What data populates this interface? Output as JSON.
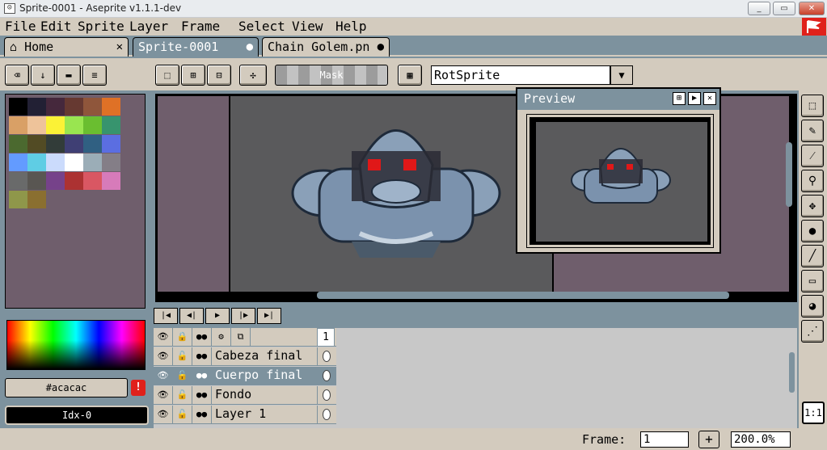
{
  "window": {
    "title": "Sprite-0001 - Aseprite v1.1.1-dev",
    "min": "_",
    "max": "▭",
    "close": "✕"
  },
  "menu": [
    "File",
    "Edit",
    "Sprite",
    "Layer",
    "Frame",
    "Select",
    "View",
    "Help"
  ],
  "tabs": [
    {
      "label": "Home",
      "close": "✕"
    },
    {
      "label": "Sprite-0001",
      "close": "●"
    },
    {
      "label": "Chain Golem.pn",
      "close": "●"
    }
  ],
  "toolbar": {
    "mask_label": "Mask",
    "rotation_algorithm": "RotSprite"
  },
  "palette": {
    "colors": [
      "#000000",
      "#222034",
      "#45283c",
      "#663931",
      "#8f563b",
      "#df7126",
      "#d9a066",
      "#eec39a",
      "#fbf236",
      "#99e550",
      "#6abe30",
      "#37946e",
      "#4b692f",
      "#524b24",
      "#323c39",
      "#3f3f74",
      "#306082",
      "#5b6ee1",
      "#639bff",
      "#5fcde4",
      "#cbdbfc",
      "#ffffff",
      "#9badb7",
      "#847e87",
      "#696a6a",
      "#595652",
      "#76428a",
      "#ac3232",
      "#d95763",
      "#d77bba",
      "#8f974a",
      "#8a6f30"
    ]
  },
  "color_bar": {
    "hex": "#acacac",
    "warning": "!",
    "index": "Idx-0"
  },
  "preview": {
    "title": "Preview"
  },
  "layers": {
    "frame_number": "1",
    "rows": [
      {
        "name": "Cabeza final",
        "selected": false
      },
      {
        "name": "Cuerpo final",
        "selected": true
      },
      {
        "name": "Fondo",
        "selected": false
      },
      {
        "name": "Layer 1",
        "selected": false
      }
    ]
  },
  "status": {
    "frame_label": "Frame:",
    "frame_value": "1",
    "plus": "+",
    "zoom": "200.0%",
    "one_to_one": "1:1"
  }
}
